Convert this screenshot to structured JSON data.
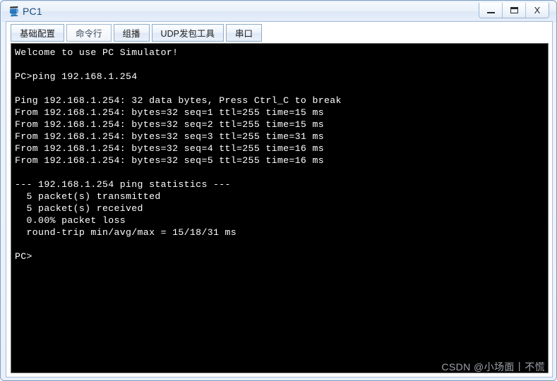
{
  "window": {
    "title": "PC1",
    "icon": "pc-monitor-icon",
    "controls": {
      "minimize_label": "—",
      "maximize_label": "❐",
      "close_label": "X"
    },
    "frame_color": "#7a9ec4",
    "title_color": "#1c4a7e"
  },
  "tabs": [
    {
      "id": "tab-basic-config",
      "label": "基础配置",
      "active": false
    },
    {
      "id": "tab-command-line",
      "label": "命令行",
      "active": true
    },
    {
      "id": "tab-multicast",
      "label": "组播",
      "active": false
    },
    {
      "id": "tab-udp-tool",
      "label": "UDP发包工具",
      "active": false
    },
    {
      "id": "tab-serial-port",
      "label": "串口",
      "active": false
    }
  ],
  "terminal": {
    "background": "#000000",
    "foreground": "#ffffff",
    "lines": [
      "Welcome to use PC Simulator!",
      "",
      "PC>ping 192.168.1.254",
      "",
      "Ping 192.168.1.254: 32 data bytes, Press Ctrl_C to break",
      "From 192.168.1.254: bytes=32 seq=1 ttl=255 time=15 ms",
      "From 192.168.1.254: bytes=32 seq=2 ttl=255 time=15 ms",
      "From 192.168.1.254: bytes=32 seq=3 ttl=255 time=31 ms",
      "From 192.168.1.254: bytes=32 seq=4 ttl=255 time=16 ms",
      "From 192.168.1.254: bytes=32 seq=5 ttl=255 time=16 ms",
      "",
      "--- 192.168.1.254 ping statistics ---",
      "  5 packet(s) transmitted",
      "  5 packet(s) received",
      "  0.00% packet loss",
      "  round-trip min/avg/max = 15/18/31 ms",
      "",
      "PC>"
    ],
    "text": "Welcome to use PC Simulator!\n\nPC>ping 192.168.1.254\n\nPing 192.168.1.254: 32 data bytes, Press Ctrl_C to break\nFrom 192.168.1.254: bytes=32 seq=1 ttl=255 time=15 ms\nFrom 192.168.1.254: bytes=32 seq=2 ttl=255 time=15 ms\nFrom 192.168.1.254: bytes=32 seq=3 ttl=255 time=31 ms\nFrom 192.168.1.254: bytes=32 seq=4 ttl=255 time=16 ms\nFrom 192.168.1.254: bytes=32 seq=5 ttl=255 time=16 ms\n\n--- 192.168.1.254 ping statistics ---\n  5 packet(s) transmitted\n  5 packet(s) received\n  0.00% packet loss\n  round-trip min/avg/max = 15/18/31 ms\n\nPC>",
    "ping_summary": {
      "target_host": "192.168.1.254",
      "data_bytes": 32,
      "break_hint": "Press Ctrl_C to break",
      "replies": [
        {
          "from": "192.168.1.254",
          "bytes": 32,
          "seq": 1,
          "ttl": 255,
          "time_ms": 15
        },
        {
          "from": "192.168.1.254",
          "bytes": 32,
          "seq": 2,
          "ttl": 255,
          "time_ms": 15
        },
        {
          "from": "192.168.1.254",
          "bytes": 32,
          "seq": 3,
          "ttl": 255,
          "time_ms": 31
        },
        {
          "from": "192.168.1.254",
          "bytes": 32,
          "seq": 4,
          "ttl": 255,
          "time_ms": 16
        },
        {
          "from": "192.168.1.254",
          "bytes": 32,
          "seq": 5,
          "ttl": 255,
          "time_ms": 16
        }
      ],
      "transmitted": 5,
      "received": 5,
      "packet_loss": "0.00%",
      "round_trip_min_avg_max": "15/18/31 ms"
    }
  },
  "watermark": {
    "text": "CSDN @小场面丨不慌",
    "color": "#b9bfc6"
  }
}
